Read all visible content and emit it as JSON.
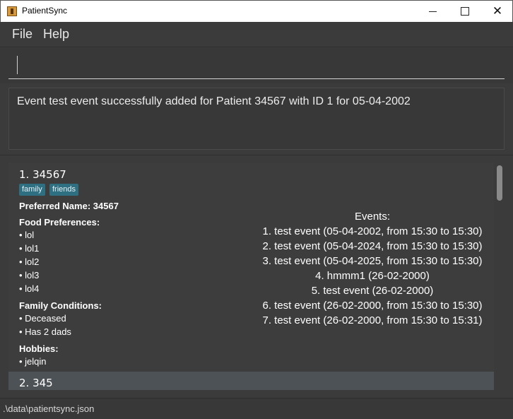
{
  "window": {
    "title": "PatientSync"
  },
  "menu": {
    "file": "File",
    "help": "Help"
  },
  "command": {
    "value": ""
  },
  "result": {
    "message": "Event test event successfully added for Patient 34567 with ID 1 for 05-04-2002"
  },
  "patients": [
    {
      "index_name": "1.  34567",
      "tags": [
        "family",
        "friends"
      ],
      "preferred_label": "Preferred Name: 34567",
      "food_label": "Food Preferences:",
      "food": [
        "• lol",
        "• lol1",
        "• lol2",
        "• lol3",
        "• lol4"
      ],
      "family_label": "Family Conditions:",
      "family": [
        "• Deceased",
        "• Has 2 dads"
      ],
      "hobbies_label": "Hobbies:",
      "hobbies": [
        "• jelqin"
      ],
      "events_label": "Events:",
      "events": [
        "1. test event (05-04-2002, from 15:30 to 15:30)",
        "2. test event (05-04-2024, from 15:30 to 15:30)",
        "3. test event (05-04-2025, from 15:30 to 15:30)",
        "4. hmmm1 (26-02-2000)",
        "5. test event (26-02-2000)",
        "6. test event (26-02-2000, from 15:30 to 15:30)",
        "7. test event (26-02-2000, from 15:30 to 15:31)"
      ]
    },
    {
      "index_name": "2.  345"
    }
  ],
  "status": {
    "path": ".\\data\\patientsync.json"
  },
  "colors": {
    "tag_bg": "#2f6f82",
    "selected_bg": "#4d5257",
    "background": "#3b3b3b"
  }
}
